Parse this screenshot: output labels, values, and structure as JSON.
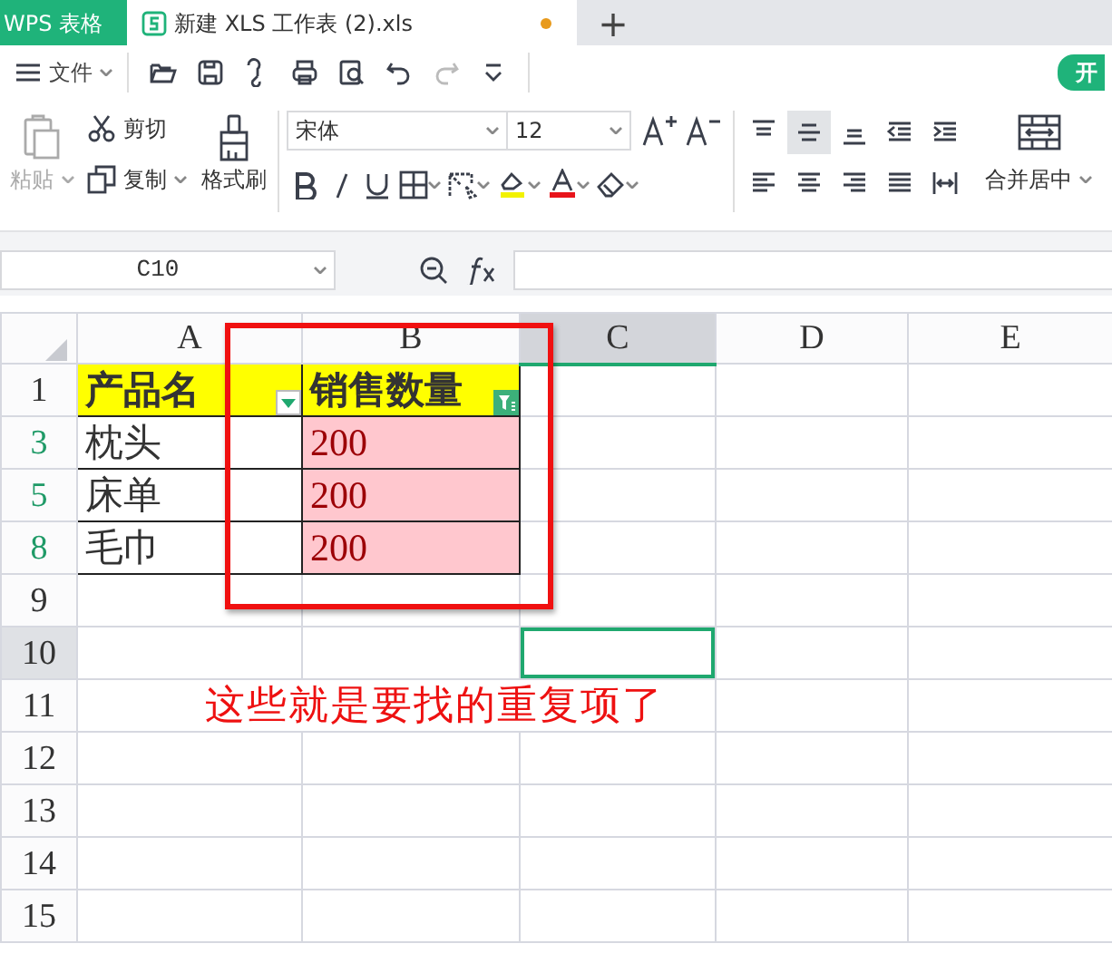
{
  "app_tab": {
    "label": "WPS 表格"
  },
  "document_tab": {
    "title": "新建 XLS 工作表 (2).xls",
    "modified": true,
    "selected": true
  },
  "new_tab_button": "+",
  "quick_toolbar": {
    "menu": "文件",
    "start_tab": "开"
  },
  "ribbon": {
    "clipboard": [
      {
        "label": "粘贴",
        "disabled": true
      },
      {
        "label": "剪切",
        "disabled": false
      },
      {
        "label": "复制",
        "disabled": false
      },
      {
        "label": "格式刷",
        "disabled": false
      }
    ],
    "font": {
      "name": "宋体",
      "size": "12"
    },
    "alignment": [
      {
        "selected": false
      },
      {
        "selected": true
      },
      {
        "selected": false
      },
      {
        "selected": false
      },
      {
        "selected": false
      },
      {
        "selected": false
      },
      {
        "selected": false
      },
      {
        "selected": false
      },
      {
        "selected": false
      },
      {
        "selected": false
      }
    ],
    "merge": "合并居中"
  },
  "formula_bar": {
    "cell_reference": "C10"
  },
  "sheet": {
    "columns": [
      {
        "label": "A",
        "selected": false
      },
      {
        "label": "B",
        "selected": false
      },
      {
        "label": "C",
        "selected": true
      },
      {
        "label": "D",
        "selected": false
      },
      {
        "label": "E",
        "selected": false
      }
    ],
    "rows": [
      {
        "number": "1",
        "kind": "header",
        "filtered": false,
        "selected": false,
        "cells": [
          {
            "text": "产品名",
            "filter_active": false
          },
          {
            "text": "销售数量",
            "filter_active": true
          }
        ]
      },
      {
        "number": "3",
        "kind": "data",
        "filtered": true,
        "selected": false,
        "cells": [
          {
            "text": "枕头",
            "highlighted": false
          },
          {
            "text": "200",
            "highlighted": true
          }
        ]
      },
      {
        "number": "5",
        "kind": "data",
        "filtered": true,
        "selected": false,
        "cells": [
          {
            "text": "床单",
            "highlighted": false
          },
          {
            "text": "200",
            "highlighted": true
          }
        ]
      },
      {
        "number": "8",
        "kind": "data",
        "filtered": true,
        "selected": false,
        "cells": [
          {
            "text": "毛巾",
            "highlighted": false
          },
          {
            "text": "200",
            "highlighted": true
          }
        ]
      },
      {
        "number": "9",
        "kind": "empty",
        "filtered": false,
        "selected": false
      },
      {
        "number": "10",
        "kind": "empty",
        "filtered": false,
        "selected": true
      },
      {
        "number": "11",
        "kind": "note",
        "text": "这些就是要找的重复项了",
        "filtered": false,
        "selected": false
      },
      {
        "number": "12",
        "kind": "empty",
        "filtered": false,
        "selected": false
      },
      {
        "number": "13",
        "kind": "empty",
        "filtered": false,
        "selected": false
      },
      {
        "number": "14",
        "kind": "empty",
        "filtered": false,
        "selected": false
      },
      {
        "number": "15",
        "kind": "empty",
        "filtered": false,
        "selected": false
      }
    ]
  }
}
